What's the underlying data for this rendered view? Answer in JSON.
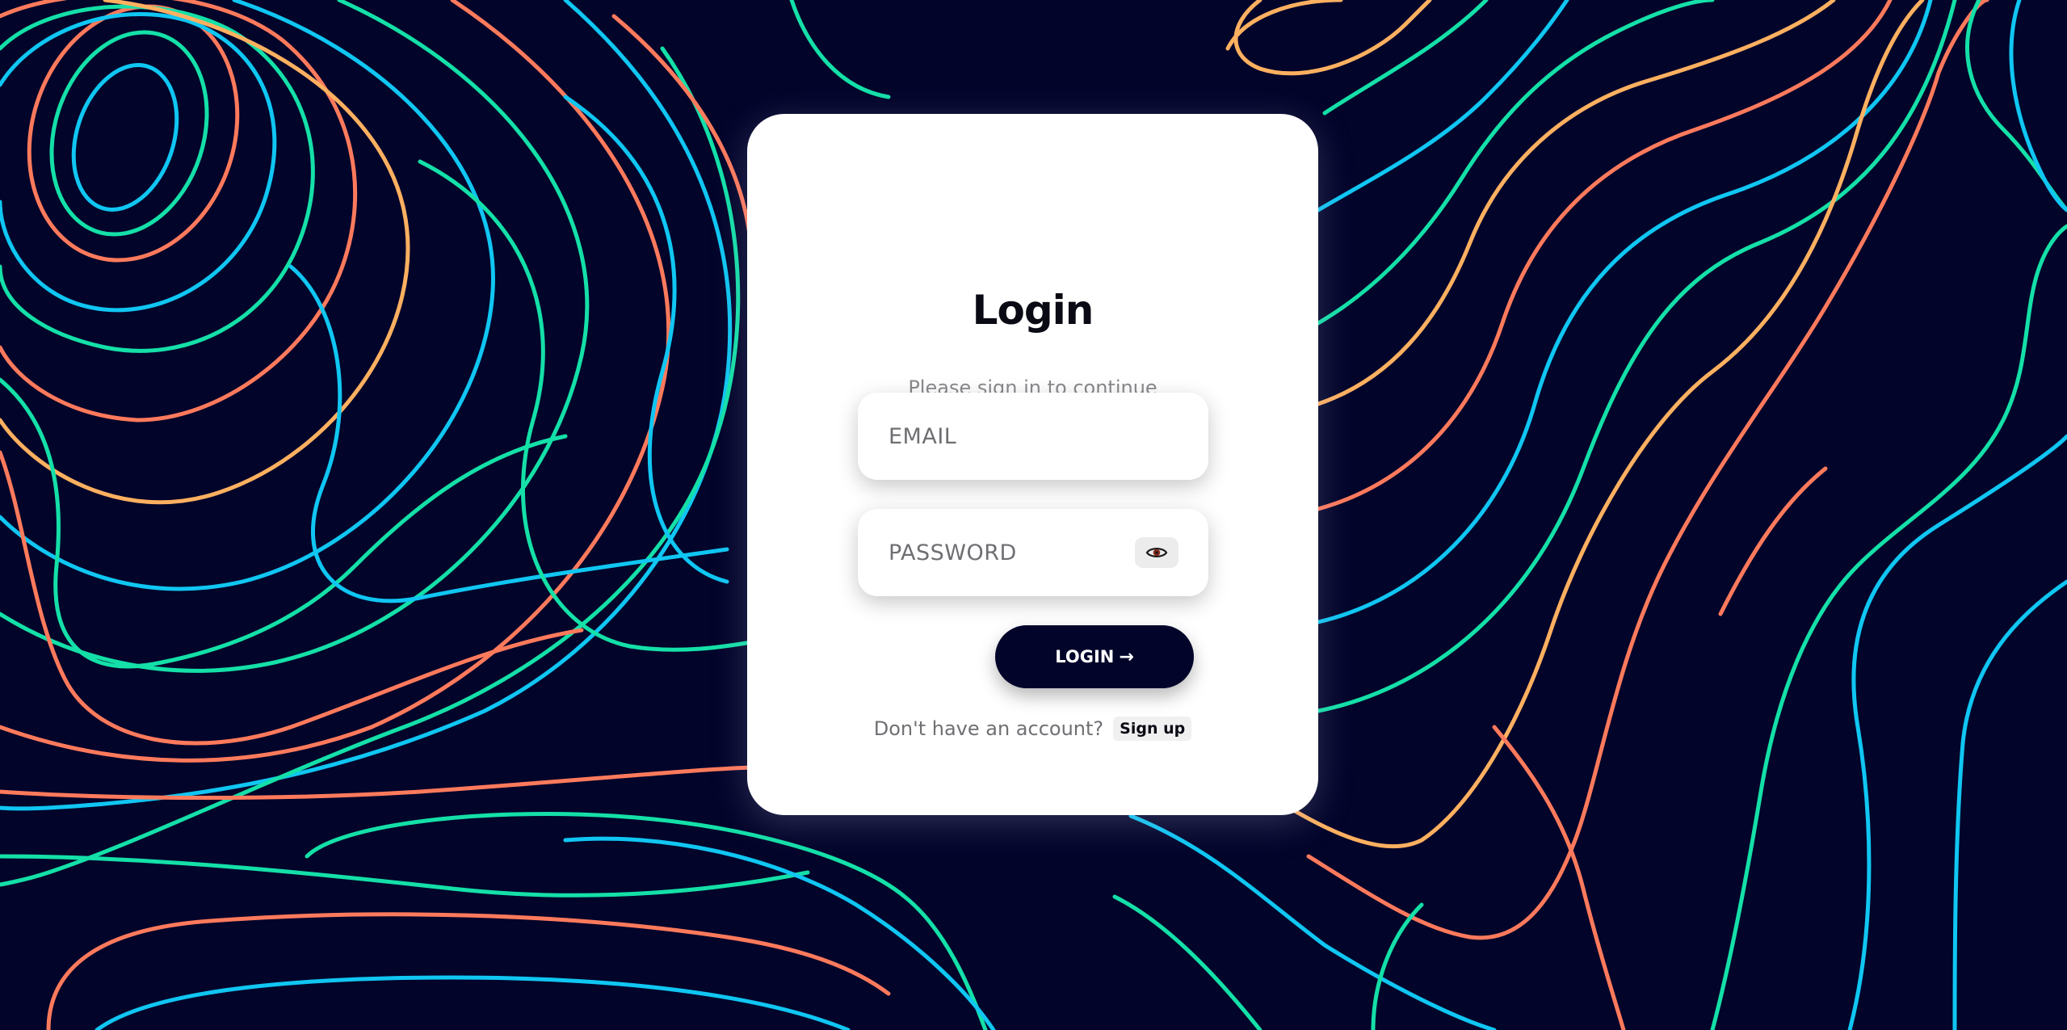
{
  "colors": {
    "background": "#02042a",
    "contour_orange": "#ff7a5c",
    "contour_cyan": "#10c6f2",
    "contour_green": "#14e0a8",
    "contour_yellow": "#ffb060",
    "button": "#02042a"
  },
  "card": {
    "title": "Login",
    "subtitle": "Please sign in to continue"
  },
  "form": {
    "email_placeholder": "EMAIL",
    "password_placeholder": "PASSWORD",
    "password_toggle_icon": "eye-icon",
    "login_label": "LOGIN",
    "login_arrow": "→"
  },
  "signup": {
    "prompt": "Don't have an account?",
    "link_label": "Sign up"
  }
}
